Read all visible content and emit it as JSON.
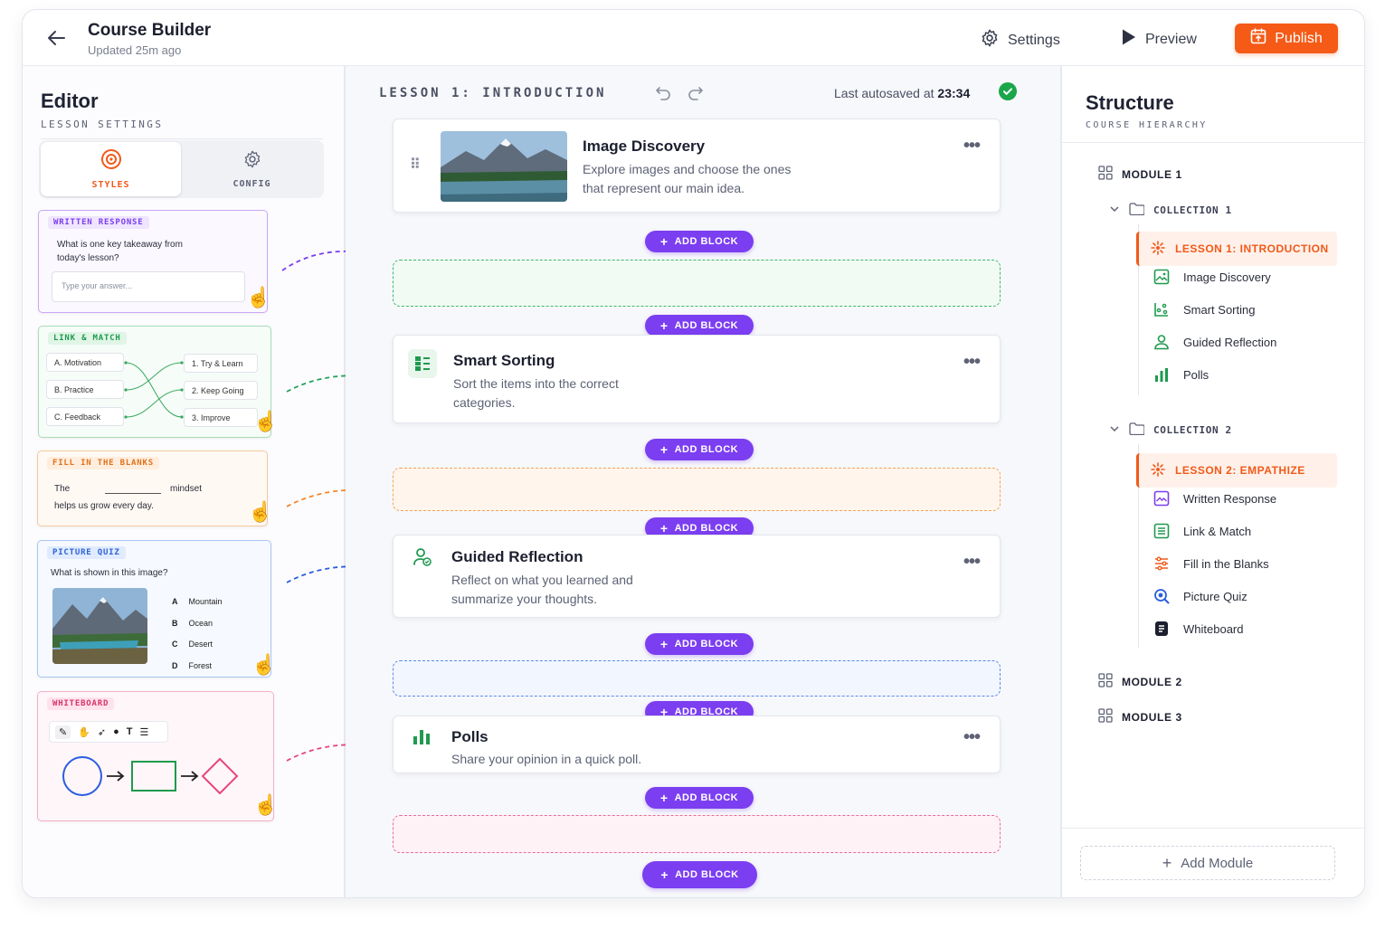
{
  "header": {
    "title": "Course Builder",
    "subtitle": "Updated 25m ago",
    "settings_label": "Settings",
    "preview_label": "Preview",
    "publish_label": "Publish"
  },
  "editor": {
    "title": "Editor",
    "subtitle": "LESSON SETTINGS",
    "tabs": [
      {
        "label": "STYLES"
      },
      {
        "label": "CONFIG"
      }
    ],
    "written_response": {
      "tag": "WRITTEN RESPONSE",
      "question": "What is one key takeaway from today's lesson?",
      "placeholder": "Type your answer..."
    },
    "link_match": {
      "tag": "LINK & MATCH",
      "left": [
        "A.  Motivation",
        "B.  Practice",
        "C.  Feedback"
      ],
      "right": [
        "1.  Try & Learn",
        "2.  Keep Going",
        "3.  Improve"
      ]
    },
    "fill_blanks": {
      "tag": "FILL IN THE BLANKS",
      "line1_start": "The",
      "line1_end": "mindset",
      "line2": "helps us grow every day."
    },
    "picture_quiz": {
      "tag": "PICTURE QUIZ",
      "question": "What is shown in this image?",
      "options": [
        {
          "letter": "A",
          "text": "Mountain"
        },
        {
          "letter": "B",
          "text": "Ocean"
        },
        {
          "letter": "C",
          "text": "Desert"
        },
        {
          "letter": "D",
          "text": "Forest"
        }
      ]
    },
    "whiteboard": {
      "tag": "WHITEBOARD"
    }
  },
  "canvas": {
    "lesson_title": "LESSON 1: INTRODUCTION",
    "autosave_prefix": "Last autosaved at",
    "autosave_time": "23:34",
    "add_block_label": "ADD BLOCK",
    "blocks": [
      {
        "name": "Image Discovery",
        "desc1": "Explore images and choose the ones",
        "desc2": "that represent our main idea."
      },
      {
        "name": "Smart Sorting",
        "desc1": "Sort the items into the correct",
        "desc2": "categories."
      },
      {
        "name": "Guided Reflection",
        "desc1": "Reflect on what you learned and",
        "desc2": "summarize your thoughts."
      },
      {
        "name": "Polls",
        "desc1": "Share your opinion in a quick poll.",
        "desc2": ""
      }
    ],
    "colors": {
      "green": "#22a55a",
      "orange": "#f5862a",
      "blue": "#3a72e8",
      "pink": "#e8457a",
      "purple": "#7b3ef0"
    }
  },
  "structure": {
    "title": "Structure",
    "subtitle": "COURSE HIERARCHY",
    "module1": "MODULE 1",
    "collection1": "COLLECTION 1",
    "lesson1": "LESSON 1: INTRODUCTION",
    "lesson1_items": [
      "Image Discovery",
      "Smart Sorting",
      "Guided Reflection",
      "Polls"
    ],
    "collection2": "COLLECTION 2",
    "lesson2": "LESSON 2: EMPATHIZE",
    "lesson2_items": [
      "Written Response",
      "Link & Match",
      "Fill in the Blanks",
      "Picture Quiz",
      "Whiteboard"
    ],
    "module2": "MODULE 2",
    "module3": "MODULE 3",
    "add_module_label": "Add Module"
  }
}
